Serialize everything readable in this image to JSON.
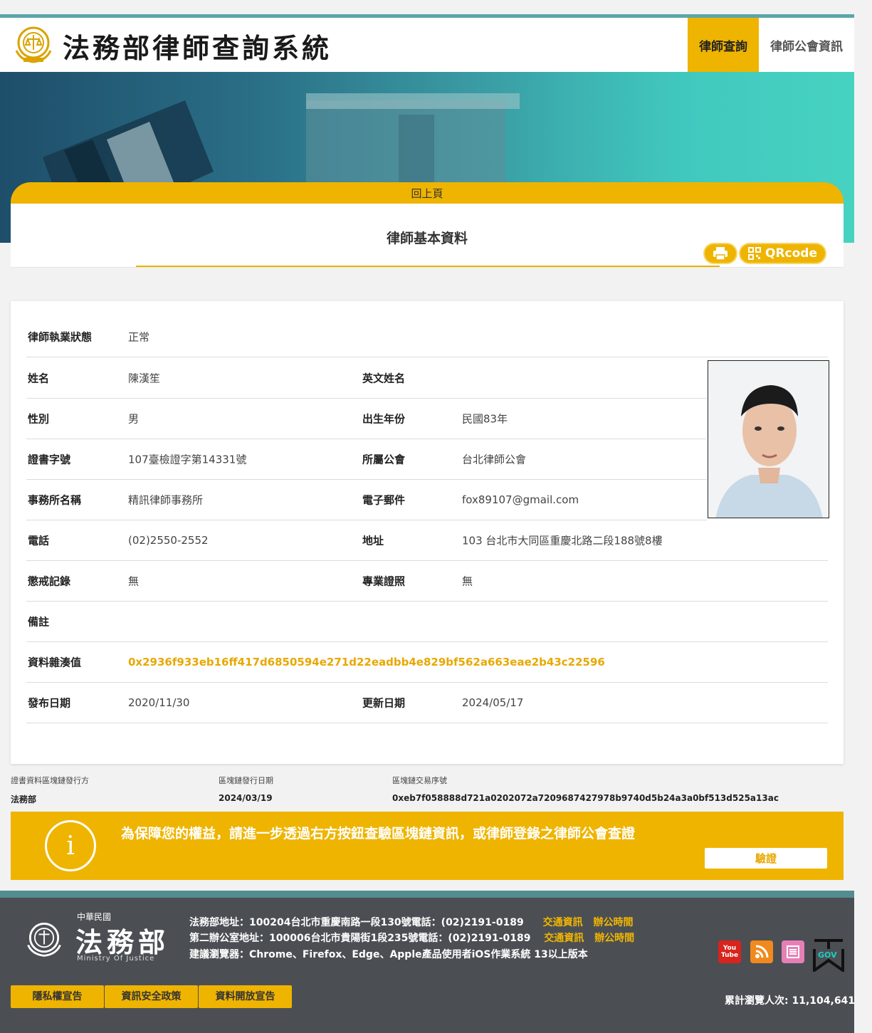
{
  "header": {
    "site_title": "法務部律師查詢系統",
    "nav": [
      "律師查詢",
      "律師公會資訊"
    ]
  },
  "colors": {
    "accent": "#efb400",
    "hash": "#e8a800",
    "footer": "#4b4f54"
  },
  "back_label": "回上頁",
  "card_title": "律師基本資料",
  "qr_label": "QRcode",
  "icons": [
    "printer-icon",
    "qrcode-icon",
    "info-icon",
    "youtube-icon",
    "rss-icon",
    "news-icon",
    "gov-icon"
  ],
  "status": {
    "label": "律師執業狀態",
    "value": "正常"
  },
  "fields": {
    "name": {
      "label": "姓名",
      "value": "陳漢笙"
    },
    "english_name": {
      "label": "英文姓名",
      "value": ""
    },
    "gender": {
      "label": "性別",
      "value": "男"
    },
    "birth_year": {
      "label": "出生年份",
      "value": "民國83年"
    },
    "certificate": {
      "label": "證書字號",
      "value": "107臺檢證字第14331號"
    },
    "bar_association": {
      "label": "所屬公會",
      "value": "台北律師公會"
    },
    "firm": {
      "label": "事務所名稱",
      "value": "精訊律師事務所"
    },
    "email": {
      "label": "電子郵件",
      "value": "fox89107@gmail.com"
    },
    "phone": {
      "label": "電話",
      "value": "(02)2550-2552"
    },
    "address": {
      "label": "地址",
      "value": "103 台北市大同區重慶北路二段188號8樓"
    },
    "discipline": {
      "label": "懲戒記錄",
      "value": "無"
    },
    "specialty": {
      "label": "專業證照",
      "value": "無"
    },
    "remarks": {
      "label": "備註",
      "value": ""
    },
    "hash": {
      "label": "資料雜湊值",
      "value": "0x2936f933eb16ff417d6850594e271d22eadbb4e829bf562a663eae2b43c22596"
    },
    "published": {
      "label": "發布日期",
      "value": "2020/11/30"
    },
    "updated": {
      "label": "更新日期",
      "value": "2024/05/17"
    }
  },
  "blockchain": {
    "issuer_label": "證書資料區塊鏈發行方",
    "issuer": "法務部",
    "date_label": "區塊鏈發行日期",
    "date": "2024/03/19",
    "tx_label": "區塊鏈交易序號",
    "tx": "0xeb7f058888d721a0202072a7209687427978b9740d5b24a3a0bf513d525a13ac"
  },
  "verify": {
    "text": "為保障您的權益，請進一步透過右方按鈕查驗區塊鏈資訊，或律師登錄之律師公會查證",
    "button": "驗證"
  },
  "footer": {
    "roc": "中華民國",
    "ministry": "法務部",
    "ministry_en": "Ministry Of Justice",
    "line1": "法務部地址：100204台北市重慶南路一段130號電話：(02)2191-0189",
    "line2": "第二辦公室地址：100006台北市貴陽街1段235號電話：(02)2191-0189",
    "line3": "建議瀏覽器：Chrome、Firefox、Edge、Apple產品使用者iOS作業系統 13以上版本",
    "traffic": "交通資訊",
    "hours": "辦公時間",
    "youtube_a": "You",
    "youtube_b": "Tube",
    "gov": "GOV",
    "policies": [
      "隱私權宣告",
      "資訊安全政策",
      "資料開放宣告"
    ],
    "visits": "累計瀏覽人次: 11,104,641"
  }
}
